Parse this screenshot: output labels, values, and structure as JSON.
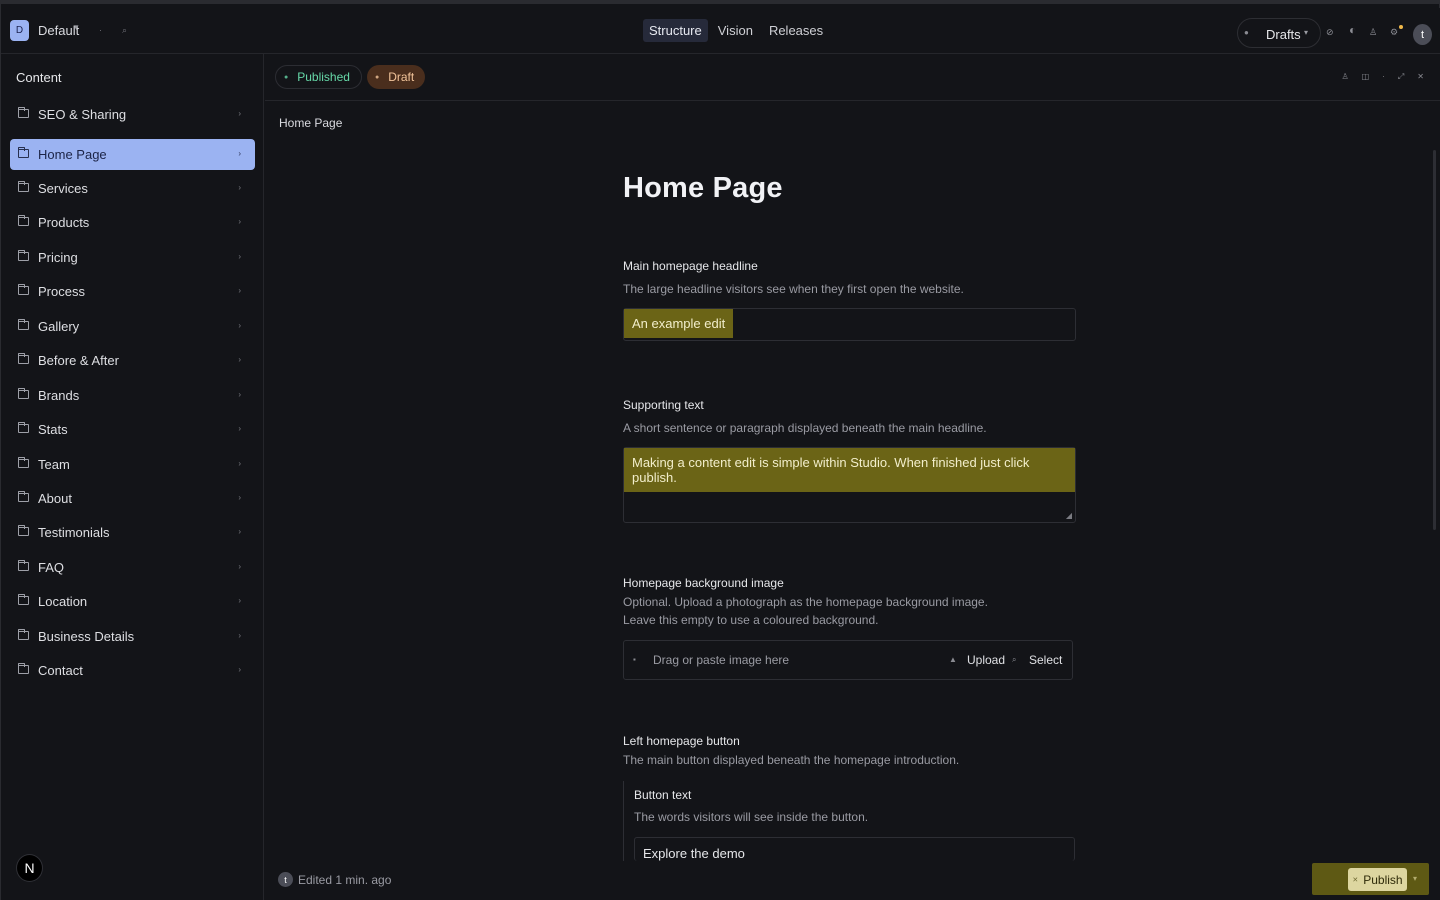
{
  "topbar": {
    "workspace_badge": "D",
    "workspace_name": "Default",
    "workspace_caret": "▾",
    "nav_tabs": [
      "Structure",
      "Vision",
      "Releases"
    ],
    "active_tab": "Structure",
    "perspective_label": "Drafts",
    "user_initial": "t"
  },
  "sidebar": {
    "title": "Content",
    "items": [
      {
        "label": "SEO & Sharing"
      },
      {
        "label": "Home Page"
      },
      {
        "label": "Services"
      },
      {
        "label": "Products"
      },
      {
        "label": "Pricing"
      },
      {
        "label": "Process"
      },
      {
        "label": "Gallery"
      },
      {
        "label": "Before & After"
      },
      {
        "label": "Brands"
      },
      {
        "label": "Stats"
      },
      {
        "label": "Team"
      },
      {
        "label": "About"
      },
      {
        "label": "Testimonials"
      },
      {
        "label": "FAQ"
      },
      {
        "label": "Location"
      },
      {
        "label": "Business Details"
      },
      {
        "label": "Contact"
      }
    ],
    "active_item": "Home Page",
    "bottom_badge": "N"
  },
  "document": {
    "tabs": {
      "published": "Published",
      "draft": "Draft"
    },
    "breadcrumb": "Home Page",
    "title": "Home Page",
    "fields": {
      "headline": {
        "label": "Main homepage headline",
        "description": "The large headline visitors see when they first open the website.",
        "value": "An example edit"
      },
      "supporting": {
        "label": "Supporting text",
        "description": "A short sentence or paragraph displayed beneath the main headline.",
        "value": "Making a content edit is simple within Studio. When finished just click publish."
      },
      "background": {
        "label": "Homepage background image",
        "description": "Optional. Upload a photograph as the homepage background image. Leave this empty to use a coloured background.",
        "placeholder": "Drag or paste image here",
        "upload_label": "Upload",
        "select_label": "Select"
      },
      "left_button": {
        "label": "Left homepage button",
        "description": "The main button displayed beneath the homepage introduction.",
        "button_text_label": "Button text",
        "button_text_description": "The words visitors will see inside the button.",
        "button_text_value": "Explore the demo"
      }
    },
    "status": "Edited 1 min. ago",
    "status_initial": "t",
    "publish_label": "Publish"
  },
  "colors": {
    "accent_nav": "#9bb3f2",
    "published_green": "#66d8a8",
    "draft_bg": "#4a2e1d",
    "highlight": "#6b6416",
    "publish_bg": "#ddd6a0"
  }
}
